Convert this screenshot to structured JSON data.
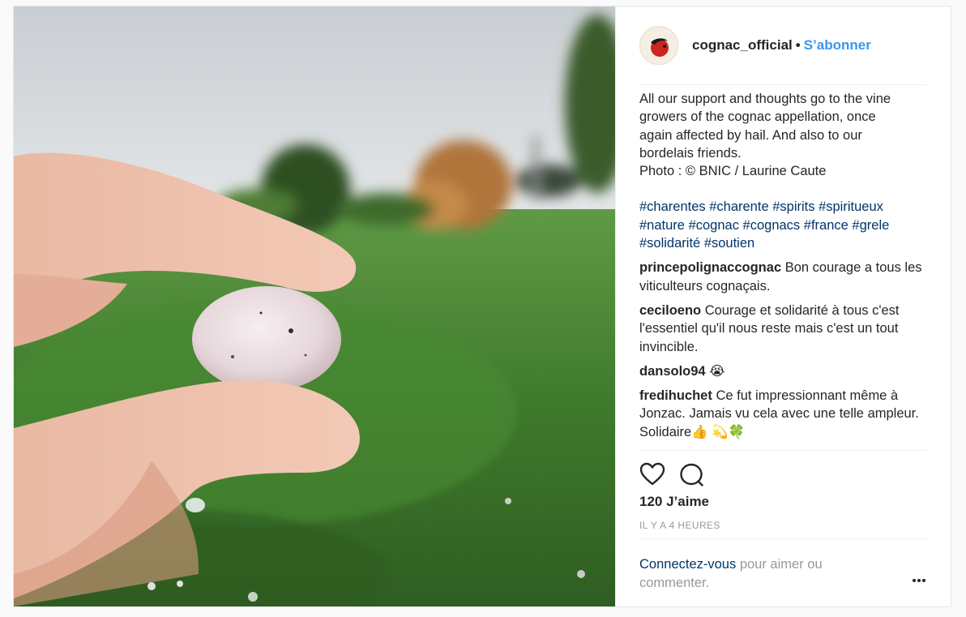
{
  "post": {
    "username": "cognac_official",
    "separator": "•",
    "follow_label": "S’abonner",
    "caption_lines": [
      "All our support and thoughts go to the vine",
      "growers of the cognac appellation, once",
      "again affected by hail. And also to our",
      "bordelais friends.",
      "Photo : © BNIC / Laurine Caute"
    ],
    "hashtags": [
      "#charentes",
      "#charente",
      "#spirits",
      "#spiritueux",
      "#nature",
      "#cognac",
      "#cognacs",
      "#france",
      "#grele",
      "#solidarité",
      "#soutien"
    ],
    "comments": [
      {
        "user": "princepolignaccognac",
        "text": "Bon courage a tous les viticulteurs cognaçais."
      },
      {
        "user": "ceciloeno",
        "text": "Courage et solidarité à tous c'est l'essentiel qu'il nous reste mais c'est un tout invincible."
      },
      {
        "user": "dansolo94",
        "text": "😭"
      },
      {
        "user": "fredihuchet",
        "text": "Ce fut impressionnant même à Jonzac. Jamais vu cela avec une telle ampleur. Solidaire👍 💫🍀"
      }
    ],
    "likes": "120 J’aime",
    "time": "IL Y A 4 HEURES",
    "login_link": "Connectez-vous",
    "login_rest": "pour aimer ou commenter.",
    "icons": {
      "like": "heart-icon",
      "comment": "comment-bubble-icon",
      "more": "more-options-icon"
    },
    "colors": {
      "link": "#003569",
      "follow": "#3897f0",
      "muted": "#999999"
    }
  }
}
